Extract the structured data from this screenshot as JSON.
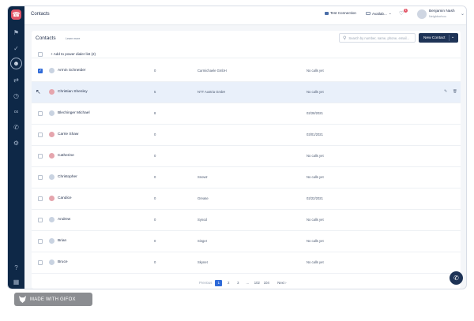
{
  "topbar": {
    "title": "Contacts",
    "connection_label": "Test Connection",
    "availability_label": "Availab...",
    "notification_count": "1",
    "user_name": "Benjamin Nash",
    "user_role": "Neighborhoo"
  },
  "card": {
    "title": "Contacts",
    "learn_more": "Learn more",
    "search_placeholder": "Search by number, name, phone, email...",
    "new_contact_label": "New Contact",
    "add_to_dialer": "+ Add to power dialer list (2)"
  },
  "rows": [
    {
      "name": "Armin Schneider",
      "num": "0",
      "org": "Carmichaele GmbH",
      "calls": "No calls yet",
      "checked": true,
      "avatar": "blue"
    },
    {
      "name": "Christian Shenley",
      "num": "5",
      "org": "NTT Austria GmbH",
      "calls": "No calls yet",
      "checked": false,
      "avatar": "red",
      "highlight": true
    },
    {
      "name": "Blechinger Michael",
      "num": "8",
      "org": "",
      "calls": "02/28/2021",
      "checked": false,
      "avatar": "blue"
    },
    {
      "name": "Carrie Shaw",
      "num": "0",
      "org": "",
      "calls": "03/01/2021",
      "checked": false,
      "avatar": "red"
    },
    {
      "name": "Catherine",
      "num": "0",
      "org": "",
      "calls": "No calls yet",
      "checked": false,
      "avatar": "red"
    },
    {
      "name": "Christopher",
      "num": "0",
      "org": "Snowz",
      "calls": "No calls yet",
      "checked": false,
      "avatar": "blue"
    },
    {
      "name": "Candice",
      "num": "0",
      "org": "Grease",
      "calls": "02/22/2021",
      "checked": false,
      "avatar": "red"
    },
    {
      "name": "Andrew",
      "num": "0",
      "org": "Synod",
      "calls": "No calls yet",
      "checked": false,
      "avatar": "blue"
    },
    {
      "name": "Brian",
      "num": "0",
      "org": "Singer",
      "calls": "No calls yet",
      "checked": false,
      "avatar": "blue"
    },
    {
      "name": "Bruce",
      "num": "0",
      "org": "Skynet",
      "calls": "No calls yet",
      "checked": false,
      "avatar": "blue"
    }
  ],
  "pagination": {
    "previous": "Previous",
    "pages": [
      "1",
      "2",
      "3",
      "...",
      "102",
      "104"
    ],
    "current": "1",
    "next": "Next ›"
  },
  "watermark": "MADE WITH GIFOX",
  "colors": {
    "rail": "#0e2847",
    "primary_button": "#1e3356",
    "accent": "#2f6ad8",
    "brand": "#e25668",
    "row_highlight": "#e9f0fa"
  }
}
